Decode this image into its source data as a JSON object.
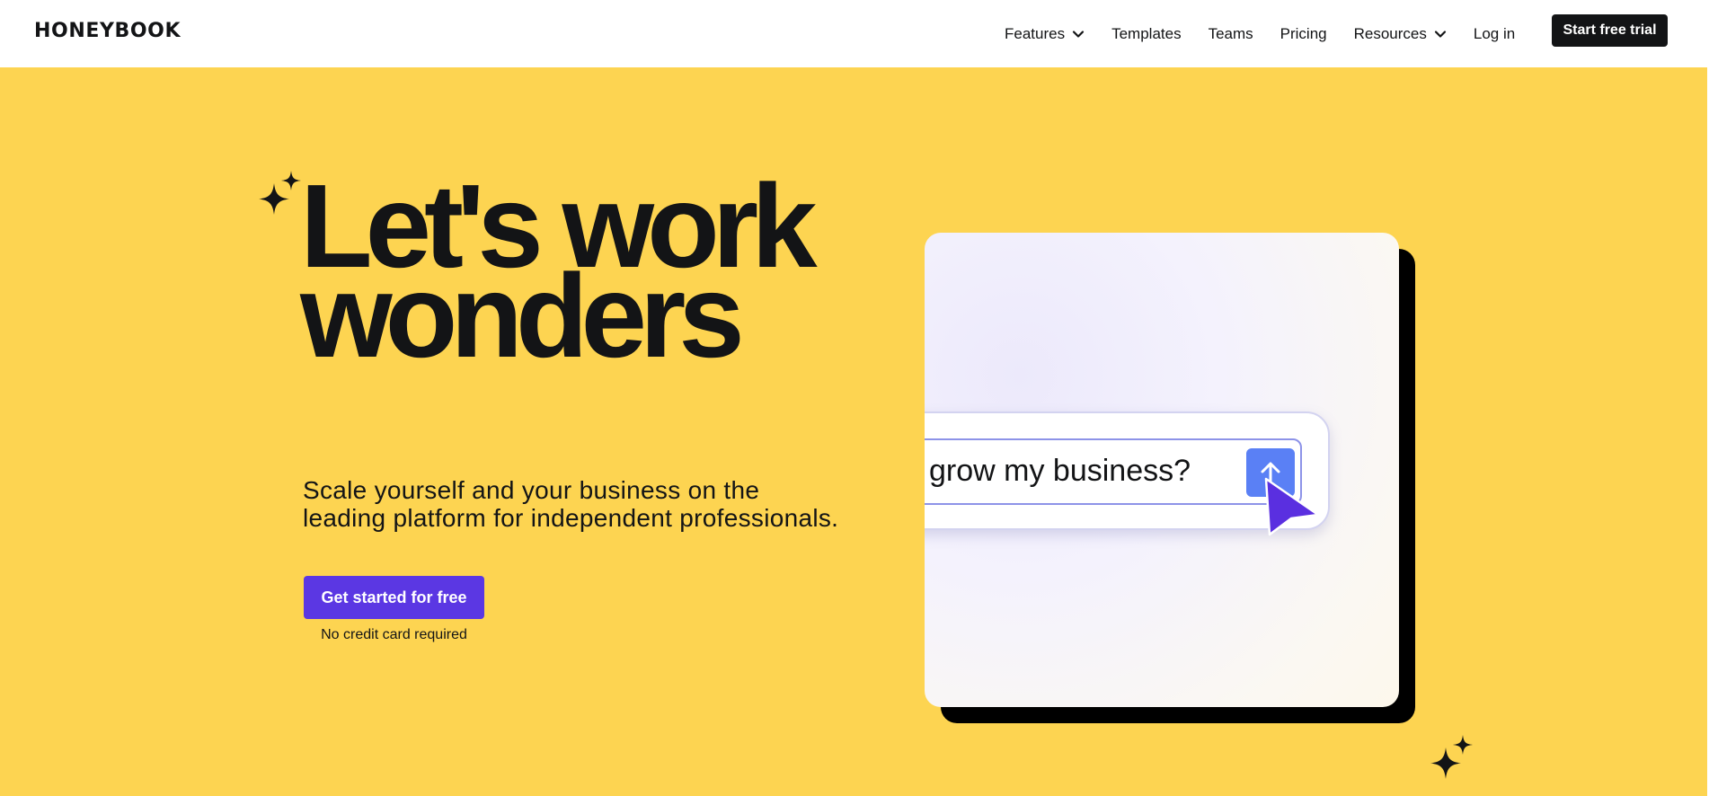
{
  "brand": {
    "logo_text": "HONEYBOOK"
  },
  "nav": {
    "items": [
      {
        "label": "Features",
        "has_dropdown": true
      },
      {
        "label": "Templates",
        "has_dropdown": false
      },
      {
        "label": "Teams",
        "has_dropdown": false
      },
      {
        "label": "Pricing",
        "has_dropdown": false
      },
      {
        "label": "Resources",
        "has_dropdown": true
      },
      {
        "label": "Log in",
        "has_dropdown": false
      }
    ],
    "cta_label": "Start free trial"
  },
  "hero": {
    "headline_line1": "Let's work",
    "headline_line2": "wonders",
    "subhead": "Scale yourself and your business on the leading platform for independent professionals.",
    "cta_label": "Get started for free",
    "cta_note": "No credit card required",
    "illustration": {
      "prompt_text": "grow my business?",
      "send_icon": "arrow-up-icon",
      "cursor_icon": "pointer-cursor-icon"
    }
  },
  "colors": {
    "hero_bg": "#fdd451",
    "primary_button": "#5b37e3",
    "top_cta": "#131416",
    "send_button": "#5a80f5",
    "text": "#131416"
  },
  "icons": [
    "sparkle-icon",
    "chevron-down-icon",
    "arrow-up-icon",
    "pointer-cursor-icon"
  ]
}
